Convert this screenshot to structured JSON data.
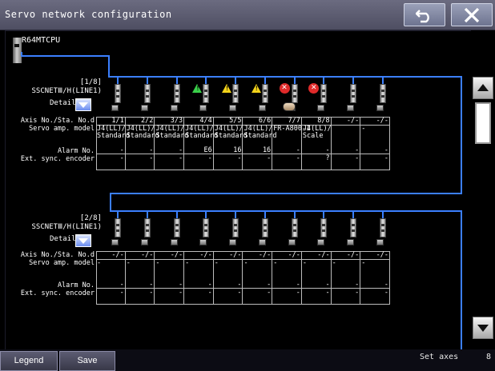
{
  "window": {
    "title": "Servo network configuration"
  },
  "toolbar": {
    "back_icon": "return-arrow-icon",
    "close_icon": "close-x-icon"
  },
  "cpu": {
    "label": "R64MTCPU"
  },
  "row_labels": {
    "axis": "Axis No./Sta. No.d",
    "model": "Servo amp. model",
    "alarm": "Alarm No.",
    "ext": "Ext. sync. encoder"
  },
  "blocks": [
    {
      "page": "[1/8]",
      "network": "SSCNETⅢ/H(LINE1)",
      "detail_label": "Detail",
      "axes": [
        {
          "axis": "1/1",
          "model1": "J4(LL)/",
          "model2": "Standard",
          "alarm": "-",
          "ext": "-",
          "status": ""
        },
        {
          "axis": "2/2",
          "model1": "J4(LL)/",
          "model2": "Standard",
          "alarm": "-",
          "ext": "-",
          "status": ""
        },
        {
          "axis": "3/3",
          "model1": "J4(LL)/",
          "model2": "Standard",
          "alarm": "-",
          "ext": "-",
          "status": ""
        },
        {
          "axis": "4/4",
          "model1": "J4(LL)/",
          "model2": "Standard",
          "alarm": "E6",
          "ext": "-",
          "status": "warn-green"
        },
        {
          "axis": "5/5",
          "model1": "J4(LL)/",
          "model2": "Standard",
          "alarm": "16",
          "ext": "-",
          "status": "warn-yellow"
        },
        {
          "axis": "6/6",
          "model1": "J4(LL)/",
          "model2": "Standard",
          "alarm": "16",
          "ext": "-",
          "status": "warn-yellow"
        },
        {
          "axis": "7/7",
          "model1": "FR-A800-1",
          "model2": "",
          "alarm": "-",
          "ext": "-",
          "status": "error"
        },
        {
          "axis": "8/8",
          "model1": "J4(LL)/",
          "model2": "Scale",
          "alarm": "-",
          "ext": "?",
          "status": "error"
        },
        {
          "axis": "-/-",
          "model1": "",
          "model2": "",
          "alarm": "-",
          "ext": "-",
          "status": ""
        },
        {
          "axis": "-/-",
          "model1": "-",
          "model2": "",
          "alarm": "-",
          "ext": "-",
          "status": ""
        }
      ]
    },
    {
      "page": "[2/8]",
      "network": "SSCNETⅢ/H(LINE1)",
      "detail_label": "Detail",
      "axes": [
        {
          "axis": "-/-",
          "model1": "-",
          "model2": "",
          "alarm": "-",
          "ext": "-",
          "status": ""
        },
        {
          "axis": "-/-",
          "model1": "-",
          "model2": "",
          "alarm": "-",
          "ext": "-",
          "status": ""
        },
        {
          "axis": "-/-",
          "model1": "-",
          "model2": "",
          "alarm": "-",
          "ext": "-",
          "status": ""
        },
        {
          "axis": "-/-",
          "model1": "-",
          "model2": "",
          "alarm": "-",
          "ext": "-",
          "status": ""
        },
        {
          "axis": "-/-",
          "model1": "-",
          "model2": "",
          "alarm": "-",
          "ext": "-",
          "status": ""
        },
        {
          "axis": "-/-",
          "model1": "-",
          "model2": "",
          "alarm": "-",
          "ext": "-",
          "status": ""
        },
        {
          "axis": "-/-",
          "model1": "-",
          "model2": "",
          "alarm": "-",
          "ext": "-",
          "status": ""
        },
        {
          "axis": "-/-",
          "model1": "-",
          "model2": "",
          "alarm": "-",
          "ext": "-",
          "status": ""
        },
        {
          "axis": "-/-",
          "model1": "-",
          "model2": "",
          "alarm": "-",
          "ext": "-",
          "status": ""
        },
        {
          "axis": "-/-",
          "model1": "-",
          "model2": "",
          "alarm": "-",
          "ext": "-",
          "status": ""
        }
      ]
    }
  ],
  "footer": {
    "legend": "Legend",
    "save": "Save",
    "status": "Set axes",
    "count": "8"
  },
  "colors": {
    "network_line": "#3b7fff",
    "warn_green": "#3ad04a",
    "warn_yellow": "#f2d21a",
    "error_red": "#e02a2a"
  }
}
